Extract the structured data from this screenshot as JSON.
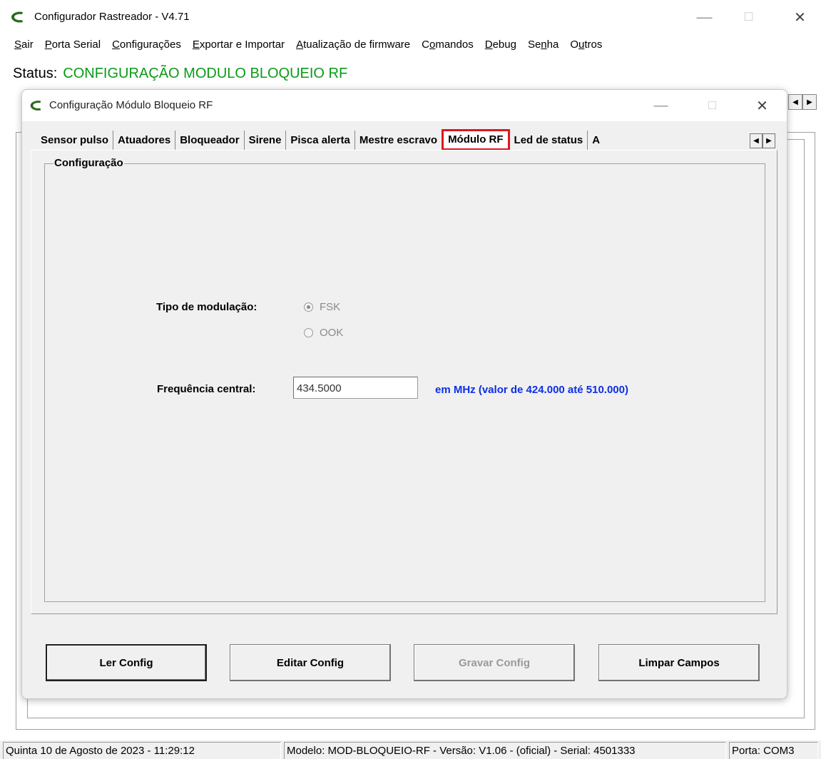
{
  "app": {
    "title": "Configurador Rastreador - V4.71",
    "minimize": "—",
    "maximize": "☐",
    "close": "✕"
  },
  "menu": [
    {
      "label": "Sair"
    },
    {
      "label": "Porta Serial"
    },
    {
      "label": "Configurações"
    },
    {
      "label": "Exportar e Importar"
    },
    {
      "label": "Atualização de firmware"
    },
    {
      "label": "Comandos"
    },
    {
      "label": "Debug"
    },
    {
      "label": "Senha"
    },
    {
      "label": "Outros"
    }
  ],
  "status": {
    "label": "Status:",
    "value": "CONFIGURAÇÃO MODULO BLOQUEIO RF",
    "value_color": "#0a9a16"
  },
  "dialog": {
    "title": "Configuração Módulo Bloqueio RF",
    "minimize": "—",
    "maximize": "☐",
    "close": "✕",
    "tabs": [
      {
        "label": "Sensor pulso"
      },
      {
        "label": "Atuadores"
      },
      {
        "label": "Bloqueador"
      },
      {
        "label": "Sirene"
      },
      {
        "label": "Pisca alerta"
      },
      {
        "label": "Mestre escravo"
      },
      {
        "label": "Módulo RF"
      },
      {
        "label": "Led de status"
      },
      {
        "label": "A"
      }
    ],
    "active_tab": "Módulo RF",
    "group": {
      "title": "Configuração",
      "modulation_label": "Tipo de modulação:",
      "modulation_options": [
        "FSK",
        "OOK"
      ],
      "modulation_selected": "FSK",
      "frequency_label": "Frequência central:",
      "frequency_value": "434.5000",
      "frequency_hint": "em MHz (valor de 424.000 até 510.000)",
      "hint_color": "#0d2ee6"
    },
    "buttons": {
      "read": "Ler Config",
      "edit": "Editar Config",
      "write": "Gravar Config",
      "clear": "Limpar Campos"
    }
  },
  "statusbar": {
    "datetime": "Quinta 10 de Agosto de 2023  -  11:29:12",
    "device": "Modelo: MOD-BLOQUEIO-RF  -  Versão: V1.06 - (oficial)  -  Serial: 4501333",
    "port": "Porta: COM3"
  }
}
